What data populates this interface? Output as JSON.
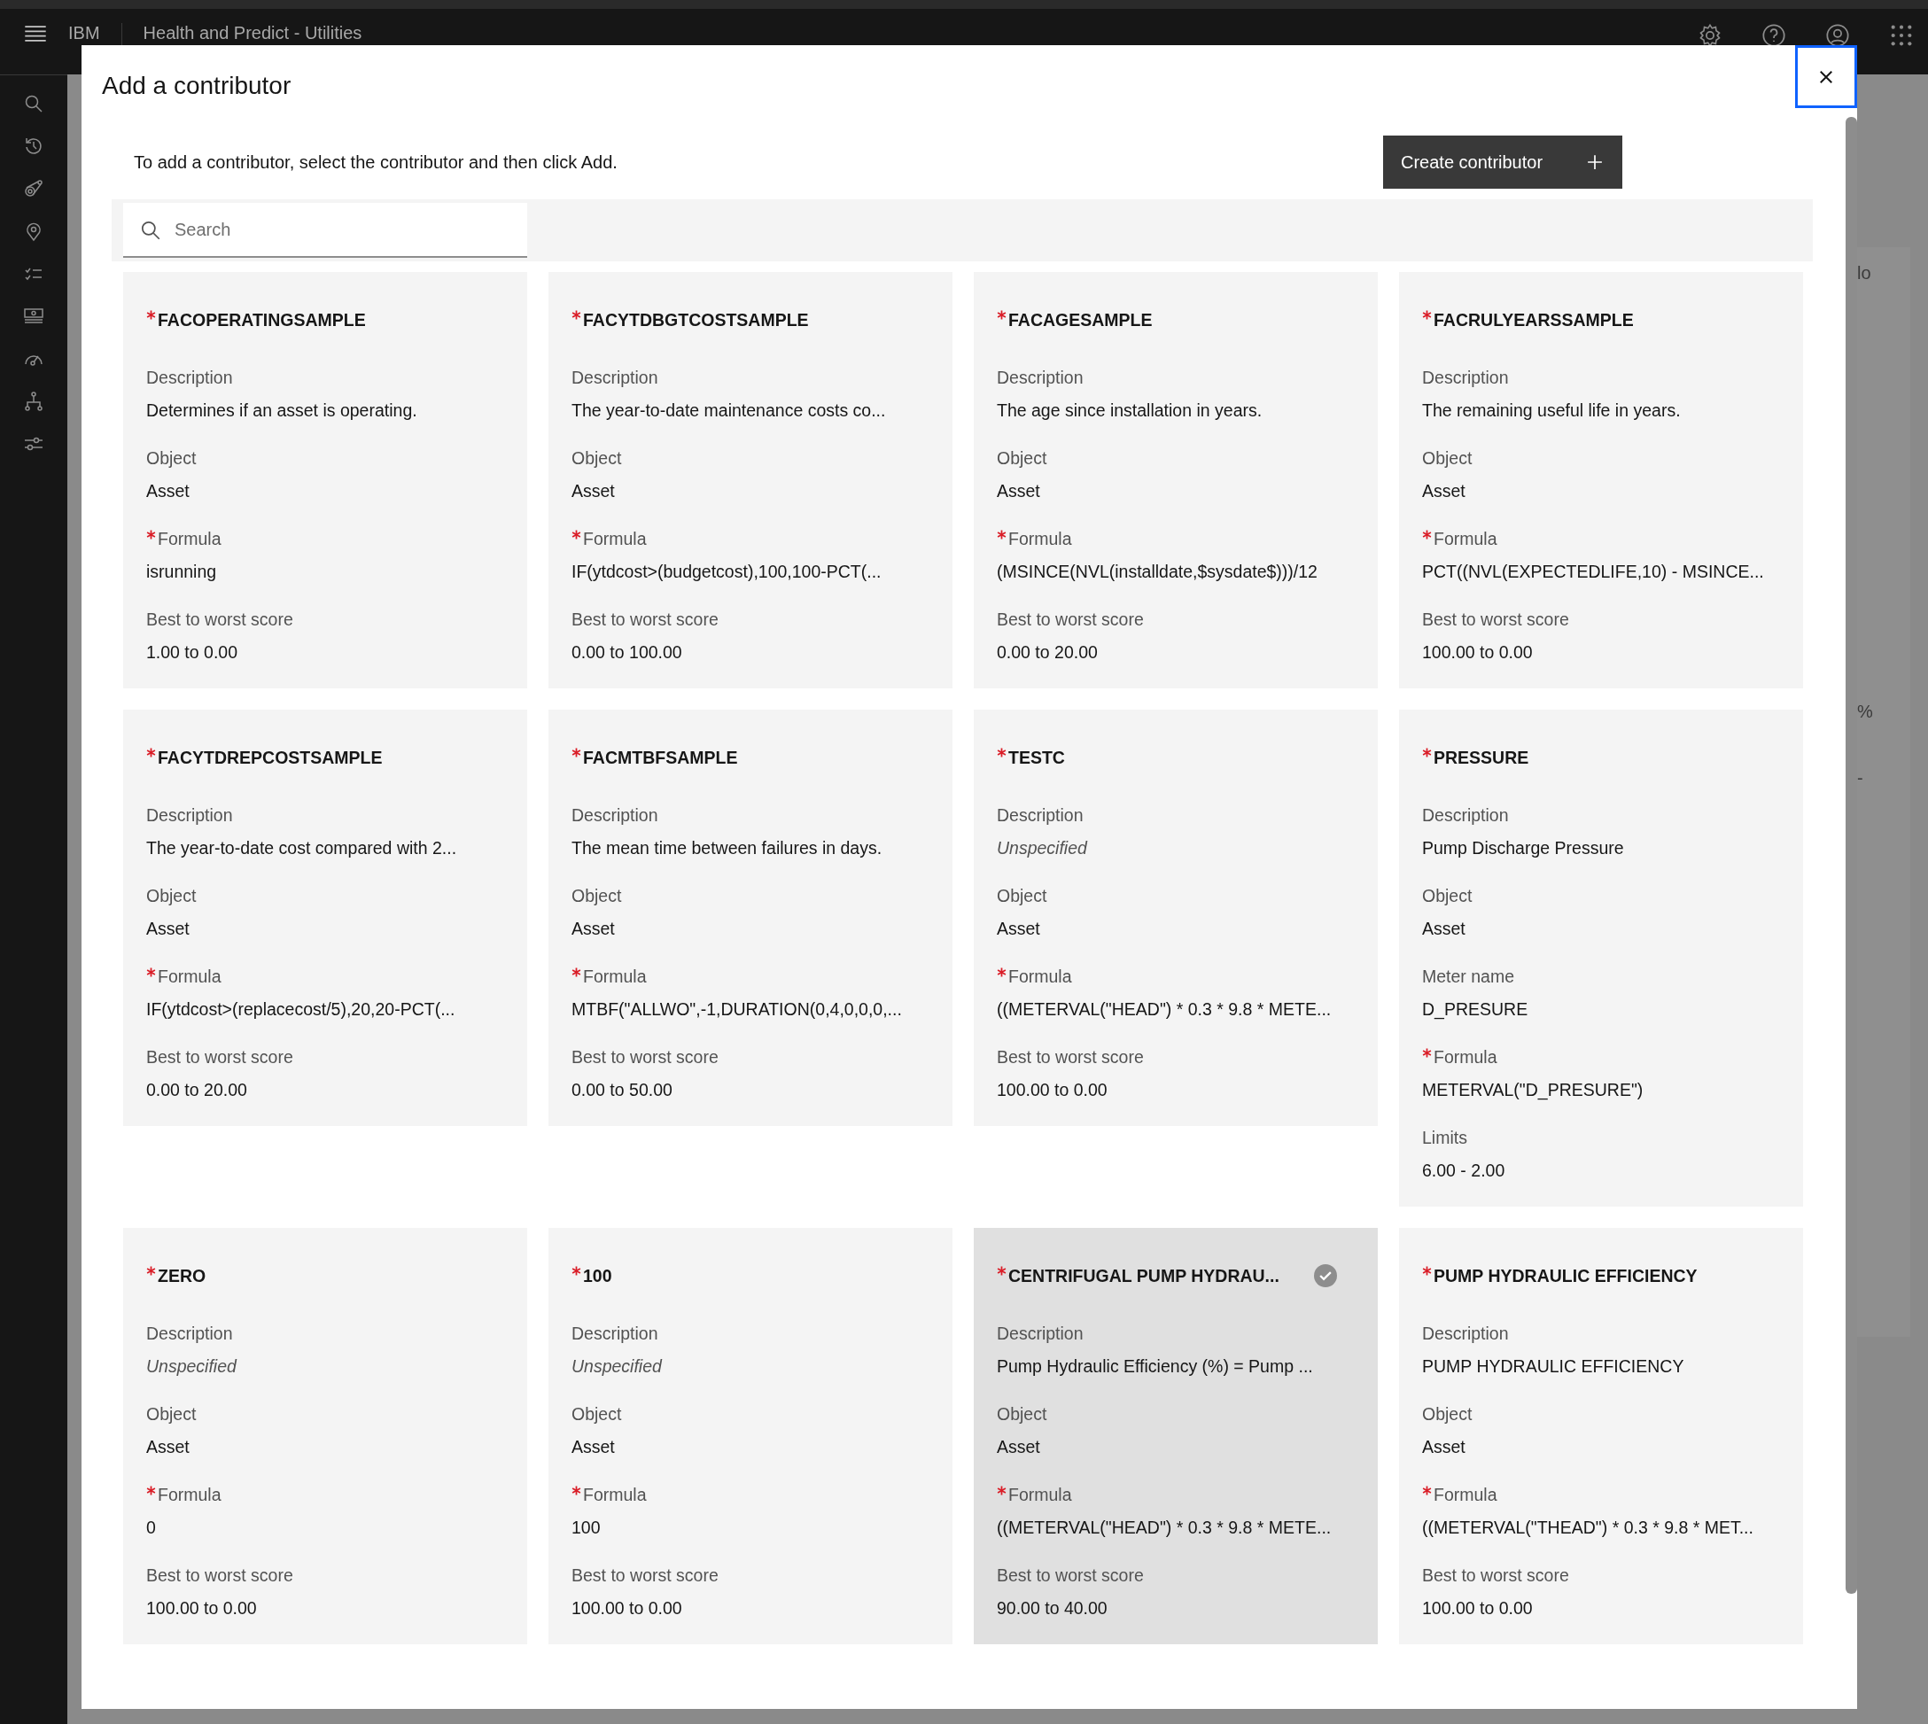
{
  "header": {
    "brand": "IBM",
    "app_title": "Health and Predict - Utilities"
  },
  "background": {
    "fragments": [
      "lo",
      "%",
      "-"
    ]
  },
  "dialog": {
    "title": "Add a contributor",
    "instructions": "To add a contributor, select the contributor and then click Add.",
    "create_button": "Create contributor",
    "search": {
      "placeholder": "Search"
    },
    "cards": [
      {
        "title": "FACOPERATINGSAMPLE",
        "required": true,
        "selected": false,
        "fields": [
          {
            "label": "Description",
            "value": "Determines if an asset is operating.",
            "required": false,
            "empty": false
          },
          {
            "label": "Object",
            "value": "Asset",
            "required": false,
            "empty": false
          },
          {
            "label": "Formula",
            "value": "isrunning",
            "required": true,
            "empty": false
          },
          {
            "label": "Best to worst score",
            "value": "1.00 to 0.00",
            "required": false,
            "empty": false
          }
        ]
      },
      {
        "title": "FACYTDBGTCOSTSAMPLE",
        "required": true,
        "selected": false,
        "fields": [
          {
            "label": "Description",
            "value": "The year-to-date maintenance costs co...",
            "required": false,
            "empty": false
          },
          {
            "label": "Object",
            "value": "Asset",
            "required": false,
            "empty": false
          },
          {
            "label": "Formula",
            "value": "IF(ytdcost>(budgetcost),100,100-PCT(...",
            "required": true,
            "empty": false
          },
          {
            "label": "Best to worst score",
            "value": "0.00 to 100.00",
            "required": false,
            "empty": false
          }
        ]
      },
      {
        "title": "FACAGESAMPLE",
        "required": true,
        "selected": false,
        "fields": [
          {
            "label": "Description",
            "value": "The age since installation in years.",
            "required": false,
            "empty": false
          },
          {
            "label": "Object",
            "value": "Asset",
            "required": false,
            "empty": false
          },
          {
            "label": "Formula",
            "value": "(MSINCE(NVL(installdate,$sysdate$)))/12",
            "required": true,
            "empty": false
          },
          {
            "label": "Best to worst score",
            "value": "0.00 to 20.00",
            "required": false,
            "empty": false
          }
        ]
      },
      {
        "title": "FACRULYEARSSAMPLE",
        "required": true,
        "selected": false,
        "fields": [
          {
            "label": "Description",
            "value": "The remaining useful life in years.",
            "required": false,
            "empty": false
          },
          {
            "label": "Object",
            "value": "Asset",
            "required": false,
            "empty": false
          },
          {
            "label": "Formula",
            "value": "PCT((NVL(EXPECTEDLIFE,10) - MSINCE...",
            "required": true,
            "empty": false
          },
          {
            "label": "Best to worst score",
            "value": "100.00 to 0.00",
            "required": false,
            "empty": false
          }
        ]
      },
      {
        "title": "FACYTDREPCOSTSAMPLE",
        "required": true,
        "selected": false,
        "fields": [
          {
            "label": "Description",
            "value": "The year-to-date cost compared with 2...",
            "required": false,
            "empty": false
          },
          {
            "label": "Object",
            "value": "Asset",
            "required": false,
            "empty": false
          },
          {
            "label": "Formula",
            "value": "IF(ytdcost>(replacecost/5),20,20-PCT(...",
            "required": true,
            "empty": false
          },
          {
            "label": "Best to worst score",
            "value": "0.00 to 20.00",
            "required": false,
            "empty": false
          }
        ]
      },
      {
        "title": "FACMTBFSAMPLE",
        "required": true,
        "selected": false,
        "fields": [
          {
            "label": "Description",
            "value": "The mean time between failures in days.",
            "required": false,
            "empty": false
          },
          {
            "label": "Object",
            "value": "Asset",
            "required": false,
            "empty": false
          },
          {
            "label": "Formula",
            "value": "MTBF(\"ALLWO\",-1,DURATION(0,4,0,0,0,...",
            "required": true,
            "empty": false
          },
          {
            "label": "Best to worst score",
            "value": "0.00 to 50.00",
            "required": false,
            "empty": false
          }
        ]
      },
      {
        "title": "TESTC",
        "required": true,
        "selected": false,
        "fields": [
          {
            "label": "Description",
            "value": "Unspecified",
            "required": false,
            "empty": true
          },
          {
            "label": "Object",
            "value": "Asset",
            "required": false,
            "empty": false
          },
          {
            "label": "Formula",
            "value": "((METERVAL(\"HEAD\") * 0.3 * 9.8 * METE...",
            "required": true,
            "empty": false
          },
          {
            "label": "Best to worst score",
            "value": "100.00 to 0.00",
            "required": false,
            "empty": false
          }
        ]
      },
      {
        "title": "PRESSURE",
        "required": true,
        "selected": false,
        "fields": [
          {
            "label": "Description",
            "value": "Pump Discharge Pressure",
            "required": false,
            "empty": false
          },
          {
            "label": "Object",
            "value": "Asset",
            "required": false,
            "empty": false
          },
          {
            "label": "Meter name",
            "value": "D_PRESURE",
            "required": false,
            "empty": false
          },
          {
            "label": "Formula",
            "value": "METERVAL(\"D_PRESURE\")",
            "required": true,
            "empty": false
          },
          {
            "label": "Limits",
            "value": "6.00 - 2.00",
            "required": false,
            "empty": false
          }
        ]
      },
      {
        "title": "ZERO",
        "required": true,
        "selected": false,
        "fields": [
          {
            "label": "Description",
            "value": "Unspecified",
            "required": false,
            "empty": true
          },
          {
            "label": "Object",
            "value": "Asset",
            "required": false,
            "empty": false
          },
          {
            "label": "Formula",
            "value": "0",
            "required": true,
            "empty": false
          },
          {
            "label": "Best to worst score",
            "value": "100.00 to 0.00",
            "required": false,
            "empty": false
          }
        ]
      },
      {
        "title": "100",
        "required": true,
        "selected": false,
        "fields": [
          {
            "label": "Description",
            "value": "Unspecified",
            "required": false,
            "empty": true
          },
          {
            "label": "Object",
            "value": "Asset",
            "required": false,
            "empty": false
          },
          {
            "label": "Formula",
            "value": "100",
            "required": true,
            "empty": false
          },
          {
            "label": "Best to worst score",
            "value": "100.00 to 0.00",
            "required": false,
            "empty": false
          }
        ]
      },
      {
        "title": "CENTRIFUGAL PUMP HYDRAU...",
        "required": true,
        "selected": true,
        "fields": [
          {
            "label": "Description",
            "value": "Pump Hydraulic Efficiency (%) = Pump ...",
            "required": false,
            "empty": false
          },
          {
            "label": "Object",
            "value": "Asset",
            "required": false,
            "empty": false
          },
          {
            "label": "Formula",
            "value": "((METERVAL(\"HEAD\") * 0.3 * 9.8 * METE...",
            "required": true,
            "empty": false
          },
          {
            "label": "Best to worst score",
            "value": "90.00 to 40.00",
            "required": false,
            "empty": false
          }
        ]
      },
      {
        "title": "PUMP HYDRAULIC EFFICIENCY",
        "required": true,
        "selected": false,
        "fields": [
          {
            "label": "Description",
            "value": "PUMP HYDRAULIC EFFICIENCY",
            "required": false,
            "empty": false
          },
          {
            "label": "Object",
            "value": "Asset",
            "required": false,
            "empty": false
          },
          {
            "label": "Formula",
            "value": "((METERVAL(\"THEAD\") * 0.3 * 9.8 * MET...",
            "required": true,
            "empty": false
          },
          {
            "label": "Best to worst score",
            "value": "100.00 to 0.00",
            "required": false,
            "empty": false
          }
        ]
      }
    ]
  }
}
